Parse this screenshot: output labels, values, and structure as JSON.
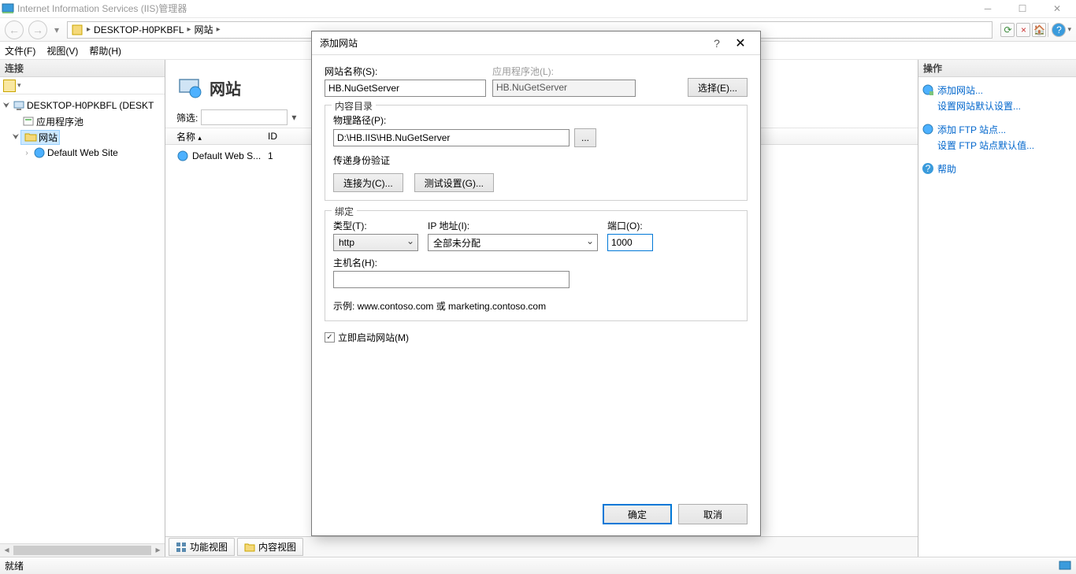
{
  "titlebar": {
    "title": "Internet Information Services (IIS)管理器"
  },
  "address": {
    "seg1": "DESKTOP-H0PKBFL",
    "seg2": "网站"
  },
  "menubar": {
    "file": "文件(F)",
    "view": "视图(V)",
    "help": "帮助(H)"
  },
  "connpanel": {
    "header": "连接",
    "tree": {
      "root": "DESKTOP-H0PKBFL (DESKT",
      "apppools": "应用程序池",
      "sites": "网站",
      "defaultsite": "Default Web Site"
    }
  },
  "center": {
    "title": "网站",
    "filter_label": "筛选:",
    "col_name": "名称",
    "col_id": "ID",
    "row1_name": "Default Web S...",
    "row1_id": "1",
    "tab1": "功能视图",
    "tab2": "内容视图"
  },
  "actions": {
    "header": "操作",
    "addsite": "添加网站...",
    "setdefaults": "设置网站默认设置...",
    "addftp": "添加 FTP 站点...",
    "setftp": "设置 FTP 站点默认值...",
    "help": "帮助"
  },
  "statusbar": {
    "ready": "就绪"
  },
  "dialog": {
    "title": "添加网站",
    "sitename_label": "网站名称(S):",
    "sitename_value": "HB.NuGetServer",
    "apppool_label": "应用程序池(L):",
    "apppool_value": "HB.NuGetServer",
    "select_btn": "选择(E)...",
    "content_legend": "内容目录",
    "physpath_label": "物理路径(P):",
    "physpath_value": "D:\\HB.IIS\\HB.NuGetServer",
    "passthrough": "传递身份验证",
    "connectas": "连接为(C)...",
    "testset": "测试设置(G)...",
    "binding_legend": "绑定",
    "type_label": "类型(T):",
    "type_value": "http",
    "ip_label": "IP 地址(I):",
    "ip_value": "全部未分配",
    "port_label": "端口(O):",
    "port_value": "1000",
    "host_label": "主机名(H):",
    "host_value": "",
    "example": "示例: www.contoso.com 或 marketing.contoso.com",
    "autostart": "立即启动网站(M)",
    "ok": "确定",
    "cancel": "取消"
  }
}
